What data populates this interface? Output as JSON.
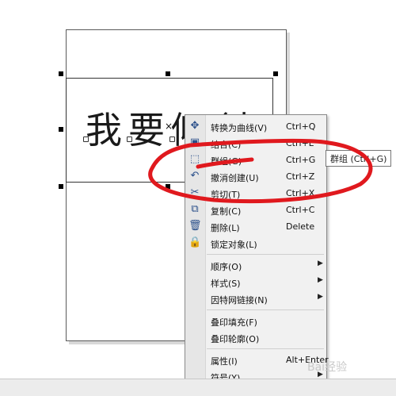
{
  "canvas": {
    "headline": "我要倾斜"
  },
  "context_menu": {
    "items": [
      {
        "icon": "shape-curve-icon",
        "label": "转换为曲线(V)",
        "shortcut": "Ctrl+Q"
      },
      {
        "icon": "combine-icon",
        "label": "结合(C)",
        "shortcut": "Ctrl+L"
      },
      {
        "icon": "group-icon",
        "label": "群组(G)",
        "shortcut": "Ctrl+G"
      },
      {
        "icon": "undo-icon",
        "label": "撤消创建(U)",
        "shortcut": "Ctrl+Z"
      },
      {
        "icon": "scissors-icon",
        "label": "剪切(T)",
        "shortcut": "Ctrl+X"
      },
      {
        "icon": "copy-icon",
        "label": "复制(C)",
        "shortcut": "Ctrl+C"
      },
      {
        "icon": "trash-icon",
        "label": "删除(L)",
        "shortcut": "Delete"
      },
      {
        "icon": "lock-icon",
        "label": "锁定对象(L)",
        "shortcut": ""
      },
      {
        "icon": "",
        "label": "顺序(O)",
        "shortcut": "",
        "submenu": true
      },
      {
        "icon": "",
        "label": "样式(S)",
        "shortcut": "",
        "submenu": true
      },
      {
        "icon": "",
        "label": "因特网链接(N)",
        "shortcut": "",
        "submenu": true
      },
      {
        "icon": "",
        "label": "叠印填充(F)",
        "shortcut": ""
      },
      {
        "icon": "",
        "label": "叠印轮廓(O)",
        "shortcut": ""
      },
      {
        "icon": "",
        "label": "属性(I)",
        "shortcut": "Alt+Enter"
      },
      {
        "icon": "",
        "label": "符号(Y)",
        "shortcut": "",
        "submenu": true
      }
    ]
  },
  "tooltip": {
    "text": "群组 (Ctrl+G)"
  },
  "annotation": {
    "color": "#e0191e"
  },
  "watermark": {
    "text": "Bai经验"
  }
}
